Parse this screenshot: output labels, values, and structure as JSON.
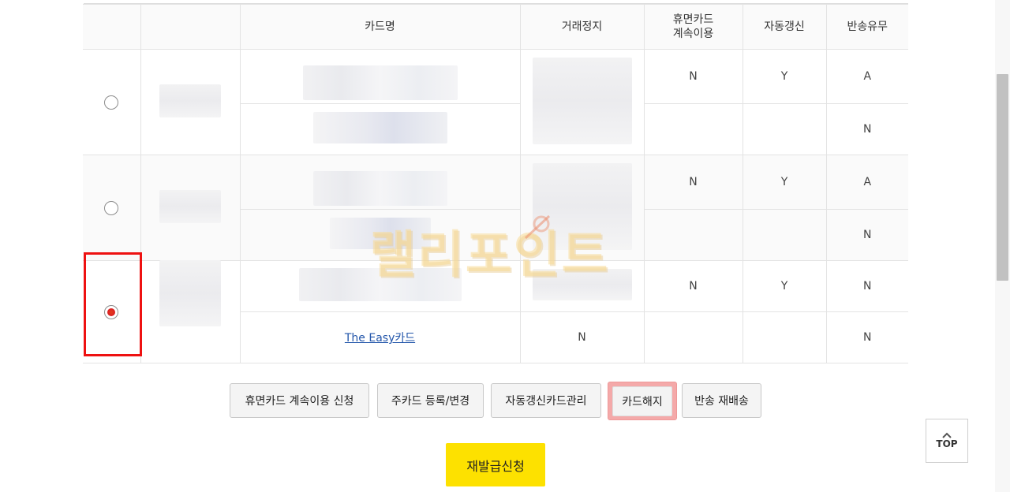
{
  "table": {
    "headers": {
      "card_name": "카드명",
      "trade_stop": "거래정지",
      "dormant_continue": "휴면카드 계속이용",
      "auto_renew": "자동갱신",
      "return_status": "반송유무"
    },
    "rows": [
      {
        "selected": false,
        "lines": [
          {
            "dormant": "N",
            "auto": "Y",
            "return": "A"
          },
          {
            "dormant": "",
            "auto": "",
            "return": "N"
          }
        ]
      },
      {
        "selected": false,
        "lines": [
          {
            "dormant": "N",
            "auto": "Y",
            "return": "A"
          },
          {
            "dormant": "",
            "auto": "",
            "return": "N"
          }
        ]
      },
      {
        "selected": true,
        "lines": [
          {
            "dormant": "N",
            "auto": "Y",
            "return": "N"
          },
          {
            "card_name": "The Easy카드",
            "trade_stop": "N",
            "dormant": "",
            "auto": "",
            "return": "N"
          }
        ]
      }
    ]
  },
  "buttons": {
    "dormant_apply": "휴면카드 계속이용 신청",
    "main_card": "주카드 등록/변경",
    "auto_renew_manage": "자동갱신카드관리",
    "card_cancel": "카드해지",
    "resend": "반송 재배송",
    "reissue": "재발급신청",
    "top": "TOP"
  },
  "watermark": "랠리포인트",
  "colors": {
    "highlight_border": "#ee1111",
    "reissue_bg": "#fde100",
    "cancel_bg": "#f4a9a9",
    "link": "#2255aa",
    "radio_checked": "#d22222"
  },
  "icons": {
    "top_button": "chevron-up-icon"
  }
}
